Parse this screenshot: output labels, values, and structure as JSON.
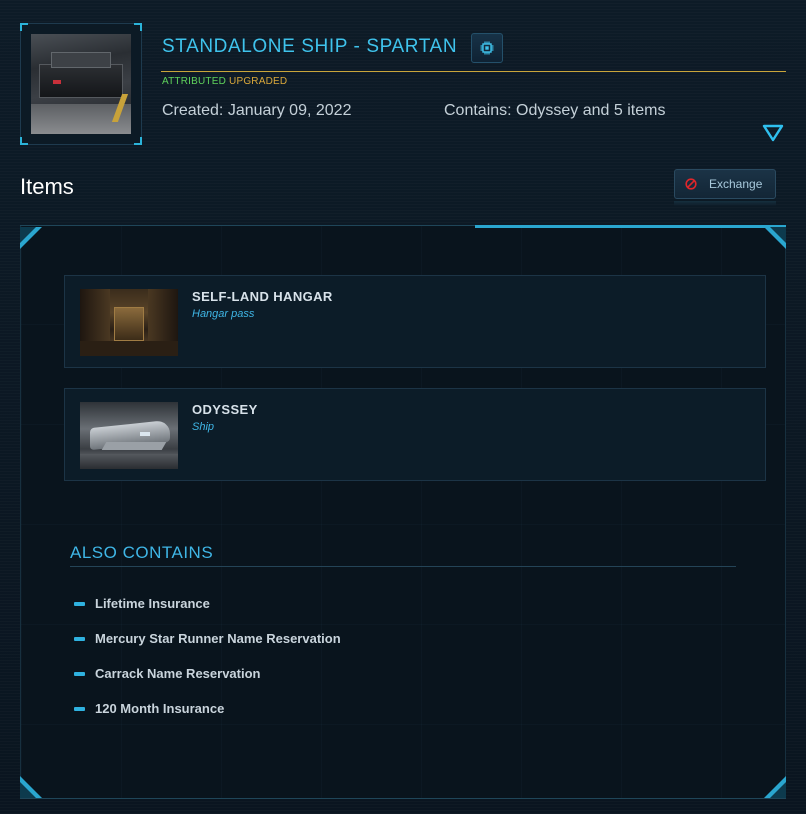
{
  "pledge": {
    "title": "STANDALONE SHIP - SPARTAN",
    "tag_attributed": "ATTRIBUTED",
    "tag_upgraded": "UPGRADED",
    "created": "Created: January 09, 2022",
    "contains": "Contains: Odyssey and 5 items",
    "thumbnail_icon": "ship-thumbnail",
    "chip_icon": "microchip-icon",
    "expand_icon": "triangle-down-icon"
  },
  "items_section": {
    "title": "Items",
    "exchange_label": "Exchange",
    "exchange_icon": "prohibited-icon"
  },
  "items": [
    {
      "name": "SELF-LAND HANGAR",
      "type": "Hangar pass"
    },
    {
      "name": "ODYSSEY",
      "type": "Ship"
    }
  ],
  "also_contains": {
    "title": "ALSO CONTAINS",
    "entries": [
      "Lifetime Insurance",
      "Mercury Star Runner Name Reservation",
      "Carrack Name Reservation",
      "120 Month Insurance"
    ]
  },
  "colors": {
    "accent": "#3fc3ec",
    "attributed": "#5fd25b",
    "upgraded": "#d9a73a",
    "background": "#0b1722"
  }
}
